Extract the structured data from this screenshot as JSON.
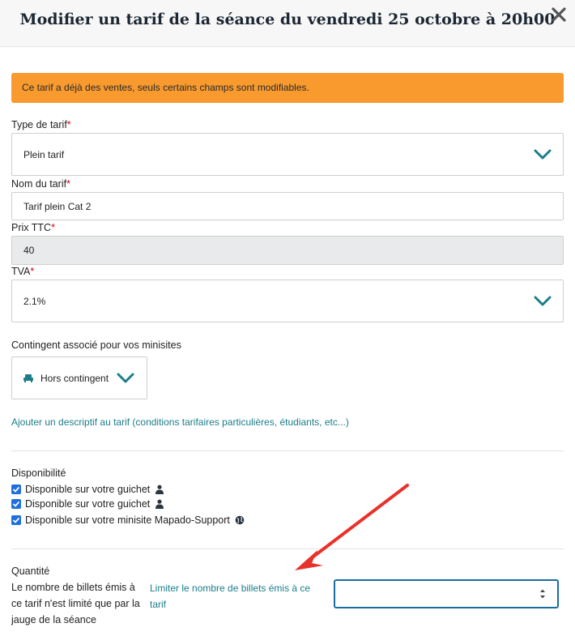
{
  "dialog": {
    "title": "Modifier un tarif de la séance du vendredi 25 octobre à 20h00",
    "close_icon": "close-icon"
  },
  "alert": {
    "text": "Ce tarif a déjà des ventes, seuls certains champs sont modifiables.",
    "color": "#f89a2e"
  },
  "fields": {
    "type": {
      "label": "Type de tarif",
      "required": "*",
      "value": "Plein tarif"
    },
    "name": {
      "label": "Nom du tarif",
      "required": "*",
      "value": "Tarif plein Cat 2"
    },
    "price": {
      "label": "Prix TTC",
      "required": "*",
      "value": "40"
    },
    "vat": {
      "label": "TVA",
      "required": "*",
      "value": "2.1%"
    }
  },
  "contingent": {
    "label": "Contingent associé pour vos minisites",
    "value": "Hors contingent",
    "icon": "seat-icon"
  },
  "description_link": "Ajouter un descriptif au tarif (conditions tarifaires particulières, étudiants, etc...)",
  "availability": {
    "label": "Disponibilité",
    "items": [
      {
        "label": "Disponible sur votre guichet",
        "checked": true,
        "icon": "person-icon"
      },
      {
        "label": "Disponible sur votre guichet",
        "checked": true,
        "icon": "person-icon"
      },
      {
        "label": "Disponible sur votre minisite Mapado-Support",
        "checked": true,
        "icon": "globe-icon"
      }
    ]
  },
  "quantity": {
    "label": "Quantité",
    "description": "Le nombre de billets émis à ce tarif n'est limité que par la jauge de la séance",
    "limit_link": "Limiter le nombre de billets émis à ce tarif",
    "input_value": ""
  },
  "colors": {
    "accent": "#1b7d8a",
    "required": "#d0021b",
    "checkbox": "#1e6fe0",
    "annotation_arrow": "#e8312a"
  }
}
